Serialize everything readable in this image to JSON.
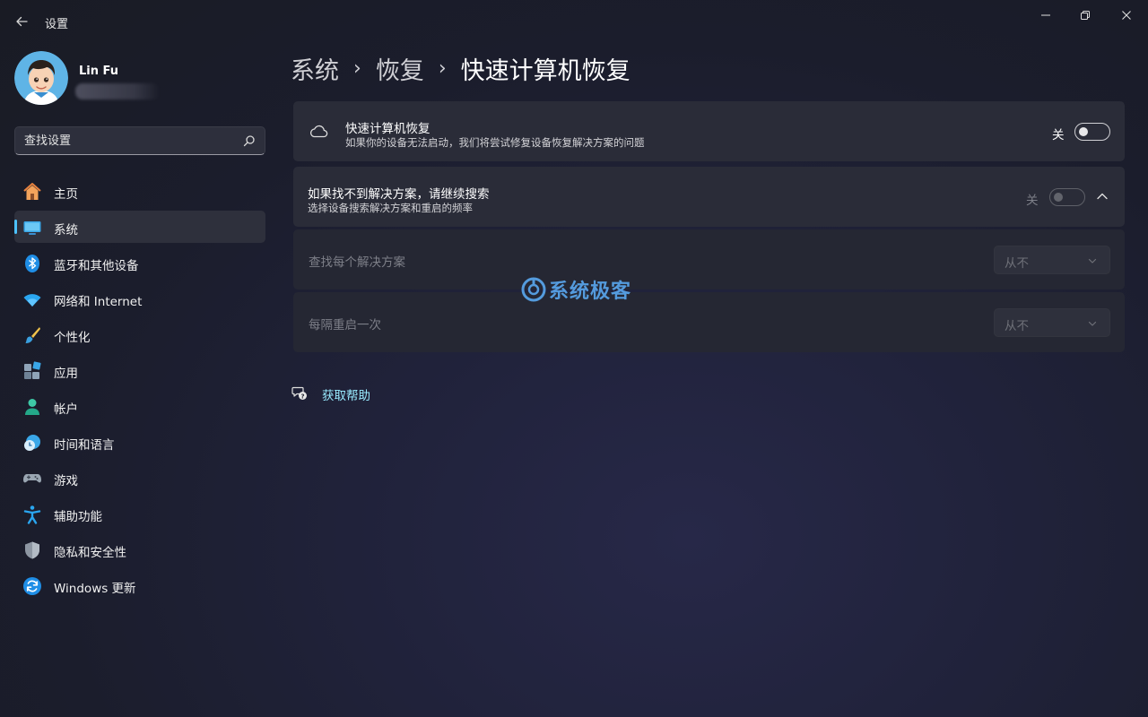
{
  "window": {
    "title": "设置",
    "back_icon": "arrow-left-icon",
    "controls": [
      "minimize-icon",
      "restore-icon",
      "close-icon"
    ]
  },
  "user": {
    "name": "Lin Fu",
    "avatar_icon": "cartoon-avatar"
  },
  "search": {
    "placeholder": "查找设置",
    "icon": "search-icon"
  },
  "sidebar": {
    "items": [
      {
        "label": "主页",
        "icon": "home-icon",
        "active": false
      },
      {
        "label": "系统",
        "icon": "monitor-icon",
        "active": true
      },
      {
        "label": "蓝牙和其他设备",
        "icon": "bluetooth-icon",
        "active": false
      },
      {
        "label": "网络和 Internet",
        "icon": "wifi-icon",
        "active": false
      },
      {
        "label": "个性化",
        "icon": "brush-icon",
        "active": false
      },
      {
        "label": "应用",
        "icon": "apps-icon",
        "active": false
      },
      {
        "label": "帐户",
        "icon": "person-icon",
        "active": false
      },
      {
        "label": "时间和语言",
        "icon": "clock-globe-icon",
        "active": false
      },
      {
        "label": "游戏",
        "icon": "gamepad-icon",
        "active": false
      },
      {
        "label": "辅助功能",
        "icon": "accessibility-icon",
        "active": false
      },
      {
        "label": "隐私和安全性",
        "icon": "shield-icon",
        "active": false
      },
      {
        "label": "Windows 更新",
        "icon": "refresh-icon",
        "active": false
      }
    ]
  },
  "breadcrumb": {
    "items": [
      "系统",
      "恢复",
      "快速计算机恢复"
    ],
    "separator": "›"
  },
  "quick_recovery": {
    "title": "快速计算机恢复",
    "description": "如果你的设备无法启动，我们将尝试修复设备恢复解决方案的问题",
    "toggle_label": "关",
    "toggle_on": false,
    "icon": "cloud-icon"
  },
  "continue_search": {
    "title": "如果找不到解决方案，请继续搜索",
    "description": "选择设备搜索解决方案和重启的频率",
    "toggle_label": "关",
    "toggle_on": false,
    "disabled": true,
    "expanded": true,
    "settings": [
      {
        "label": "查找每个解决方案",
        "value": "从不"
      },
      {
        "label": "每隔重启一次",
        "value": "从不"
      }
    ]
  },
  "help": {
    "label": "获取帮助",
    "icon": "help-chat-icon"
  },
  "watermark": {
    "text": "系统极客",
    "icon": "watermark-logo-icon"
  },
  "colors": {
    "accent": "#4cc2ff",
    "link": "#99ebff",
    "card": "#2a2c38",
    "background": "#1b1d2c"
  }
}
